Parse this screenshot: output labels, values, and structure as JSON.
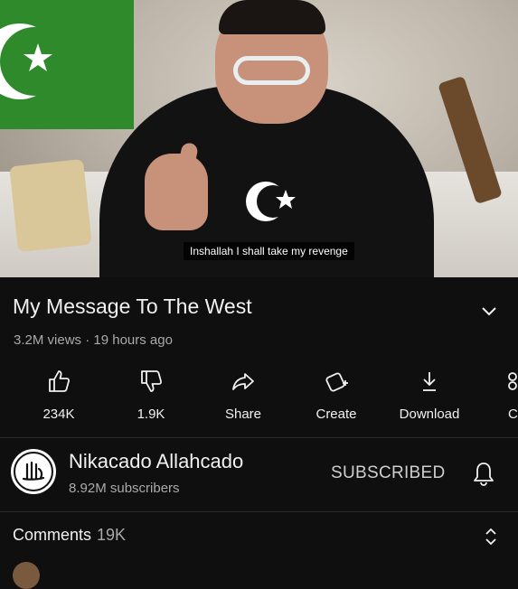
{
  "video": {
    "caption": "Inshallah I shall take my revenge"
  },
  "title": "My Message To The West",
  "meta": {
    "views": "3.2M views",
    "separator": "·",
    "age": "19 hours ago"
  },
  "actions": [
    {
      "label": "234K",
      "icon": "thumbs-up-icon"
    },
    {
      "label": "1.9K",
      "icon": "thumbs-down-icon"
    },
    {
      "label": "Share",
      "icon": "share-icon"
    },
    {
      "label": "Create",
      "icon": "create-icon"
    },
    {
      "label": "Download",
      "icon": "download-icon"
    },
    {
      "label": "C",
      "icon": "clip-icon"
    }
  ],
  "channel": {
    "name": "Nikacado Allahcado",
    "subscribers": "8.92M subscribers",
    "subscribe_label": "SUBSCRIBED"
  },
  "comments": {
    "label": "Comments",
    "count": "19K"
  },
  "colors": {
    "background": "#0f0f0f",
    "text_primary": "#f1f1f1",
    "text_secondary": "#aaaaaa",
    "flag_green": "#2f8a2c"
  }
}
